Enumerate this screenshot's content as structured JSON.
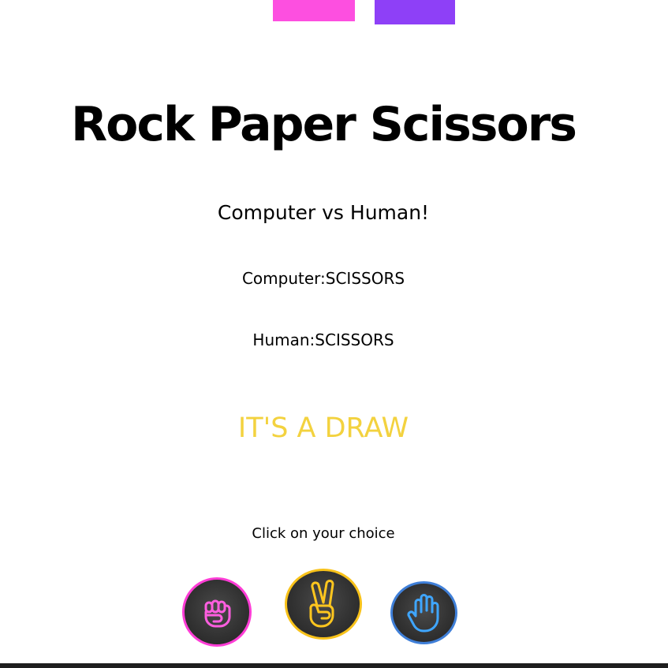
{
  "title": "Rock Paper Scissors",
  "subtitle": "Computer vs Human!",
  "computer_result": "Computer:SCISSORS",
  "human_result": "Human:SCISSORS",
  "verdict": "IT'S A DRAW",
  "prompt": "Click on your choice",
  "colors": {
    "pink_bar": "#fd4fe0",
    "purple_bar": "#8e40f7",
    "verdict": "#f3d23f",
    "rock_glow": "#ff3dd6",
    "scissors_glow": "#f8c21a",
    "paper_glow": "#3f7fd8"
  },
  "choices": [
    {
      "name": "rock",
      "icon": "fist-icon"
    },
    {
      "name": "scissors",
      "icon": "peace-hand-icon"
    },
    {
      "name": "paper",
      "icon": "open-hand-icon"
    }
  ]
}
